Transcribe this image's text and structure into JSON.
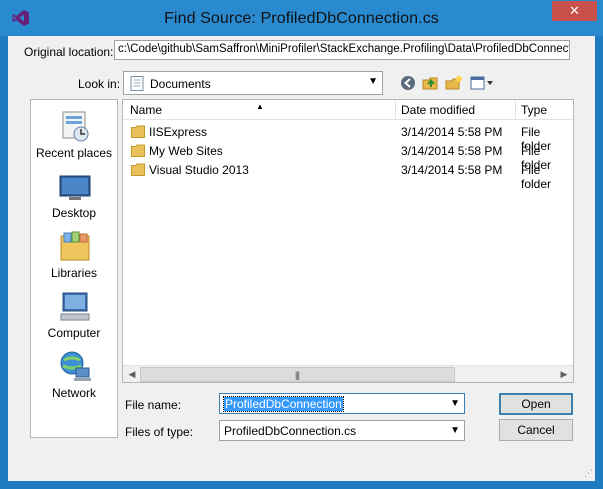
{
  "window": {
    "title": "Find Source: ProfiledDbConnection.cs",
    "close_icon": "close-icon"
  },
  "original_location": {
    "label": "Original location:",
    "value": "c:\\Code\\github\\SamSaffron\\MiniProfiler\\StackExchange.Profiling\\Data\\ProfiledDbConnection.c"
  },
  "look_in": {
    "label": "Look in:",
    "value": "Documents"
  },
  "places": [
    {
      "label": "Recent places",
      "icon": "recent-places-icon"
    },
    {
      "label": "Desktop",
      "icon": "desktop-icon"
    },
    {
      "label": "Libraries",
      "icon": "libraries-icon"
    },
    {
      "label": "Computer",
      "icon": "computer-icon"
    },
    {
      "label": "Network",
      "icon": "network-icon"
    }
  ],
  "file_list": {
    "columns": [
      "Name",
      "Date modified",
      "Type"
    ],
    "rows": [
      {
        "name": "IISExpress",
        "date": "3/14/2014 5:58 PM",
        "type": "File folder"
      },
      {
        "name": "My Web Sites",
        "date": "3/14/2014 5:58 PM",
        "type": "File folder"
      },
      {
        "name": "Visual Studio 2013",
        "date": "3/14/2014 5:58 PM",
        "type": "File folder"
      }
    ]
  },
  "file_name": {
    "label": "File name:",
    "value": "ProfiledDbConnection"
  },
  "files_of_type": {
    "label": "Files of type:",
    "value": "ProfiledDbConnection.cs"
  },
  "buttons": {
    "open": "Open",
    "cancel": "Cancel"
  },
  "colors": {
    "titlebar": "#2a8ad0",
    "close": "#c7504a",
    "selection": "#3399ff"
  }
}
